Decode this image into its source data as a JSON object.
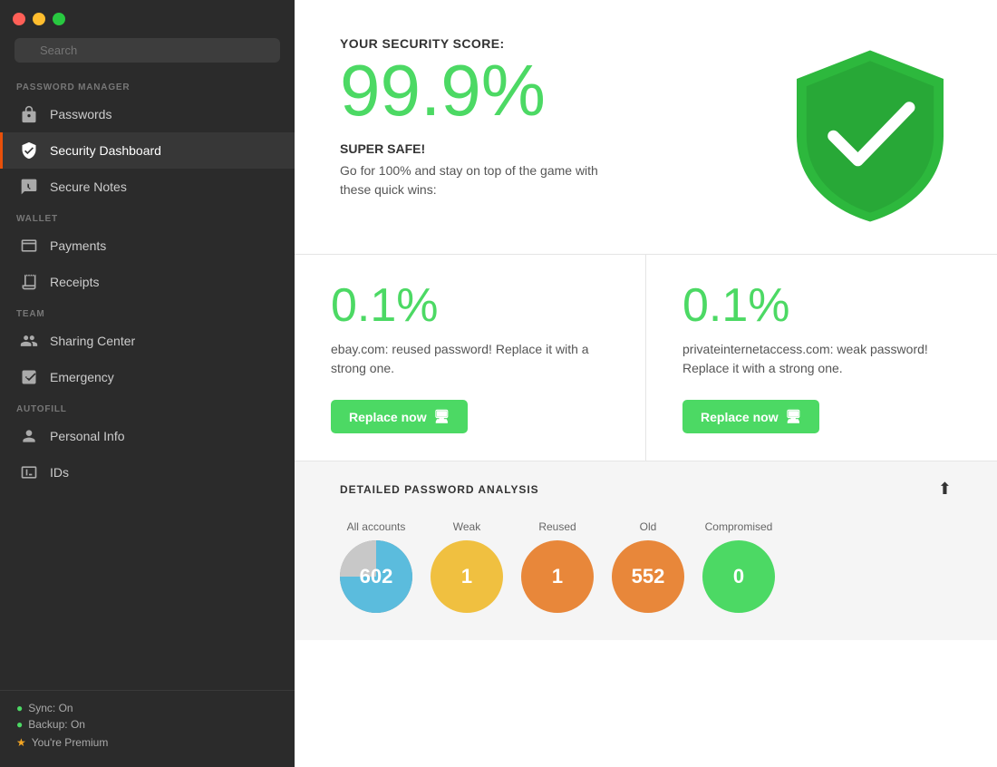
{
  "window": {
    "title": "Password Manager"
  },
  "sidebar": {
    "search_placeholder": "Search",
    "sections": [
      {
        "label": "PASSWORD MANAGER",
        "items": [
          {
            "id": "passwords",
            "label": "Passwords",
            "icon": "lock"
          },
          {
            "id": "security-dashboard",
            "label": "Security Dashboard",
            "icon": "shield-check",
            "active": true
          },
          {
            "id": "secure-notes",
            "label": "Secure Notes",
            "icon": "note-lock"
          }
        ]
      },
      {
        "label": "WALLET",
        "items": [
          {
            "id": "payments",
            "label": "Payments",
            "icon": "credit-card"
          },
          {
            "id": "receipts",
            "label": "Receipts",
            "icon": "receipt"
          }
        ]
      },
      {
        "label": "TEAM",
        "items": [
          {
            "id": "sharing-center",
            "label": "Sharing Center",
            "icon": "people"
          },
          {
            "id": "emergency",
            "label": "Emergency",
            "icon": "first-aid"
          }
        ]
      },
      {
        "label": "AUTOFILL",
        "items": [
          {
            "id": "personal-info",
            "label": "Personal Info",
            "icon": "person"
          },
          {
            "id": "ids",
            "label": "IDs",
            "icon": "id-card"
          }
        ]
      }
    ],
    "footer": {
      "sync": "Sync: On",
      "backup": "Backup: On",
      "premium": "You're Premium"
    }
  },
  "main": {
    "score_label": "YOUR SECURITY SCORE:",
    "score_value": "99.9%",
    "super_safe": "SUPER SAFE!",
    "description": "Go for 100% and stay on top of the game with these quick wins:",
    "issues": [
      {
        "percent": "0.1%",
        "description": "ebay.com: reused password! Replace it with a strong one.",
        "button_label": "Replace now"
      },
      {
        "percent": "0.1%",
        "description": "privateinternetaccess.com: weak password! Replace it with a strong one.",
        "button_label": "Replace now"
      }
    ],
    "analysis": {
      "title": "DETAILED PASSWORD ANALYSIS",
      "stats": [
        {
          "label": "All accounts",
          "value": "602",
          "color_type": "all"
        },
        {
          "label": "Weak",
          "value": "1",
          "color_type": "yellow"
        },
        {
          "label": "Reused",
          "value": "1",
          "color_type": "orange"
        },
        {
          "label": "Old",
          "value": "552",
          "color_type": "orange-dark"
        },
        {
          "label": "Compromised",
          "value": "0",
          "color_type": "green"
        }
      ]
    }
  }
}
